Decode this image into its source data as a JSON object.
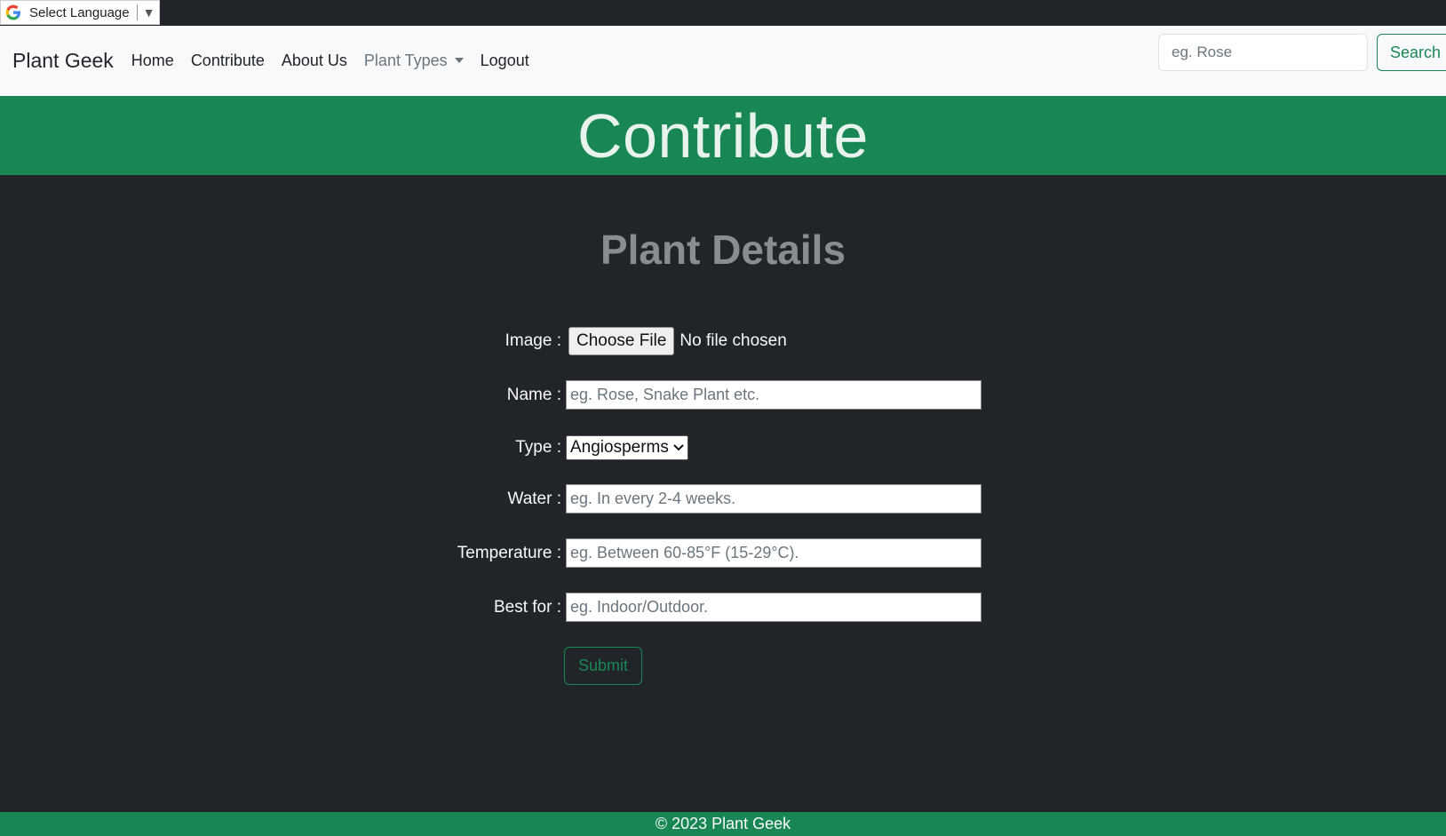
{
  "translate": {
    "label": "Select Language",
    "icon": "google-g-icon"
  },
  "navbar": {
    "brand": "Plant Geek",
    "links": [
      "Home",
      "Contribute",
      "About Us",
      "Plant Types",
      "Logout"
    ],
    "search_placeholder": "eg. Rose",
    "search_button": "Search"
  },
  "hero": {
    "title": "Contribute"
  },
  "form": {
    "title": "Plant Details",
    "image_label": "Image :",
    "choose_file": "Choose File",
    "file_status": "No file chosen",
    "name_label": "Name :",
    "name_placeholder": "eg. Rose, Snake Plant etc.",
    "type_label": "Type :",
    "type_value": "Angiosperms",
    "water_label": "Water :",
    "water_placeholder": "eg. In every 2-4 weeks.",
    "temp_label": "Temperature :",
    "temp_placeholder": "eg. Between 60-85°F (15-29°C).",
    "bestfor_label": "Best for :",
    "bestfor_placeholder": "eg. Indoor/Outdoor.",
    "submit": "Submit"
  },
  "footer": {
    "text": "© 2023 Plant Geek"
  },
  "colors": {
    "accent": "#198754",
    "dark": "#212529",
    "light": "#f8f9fa"
  }
}
